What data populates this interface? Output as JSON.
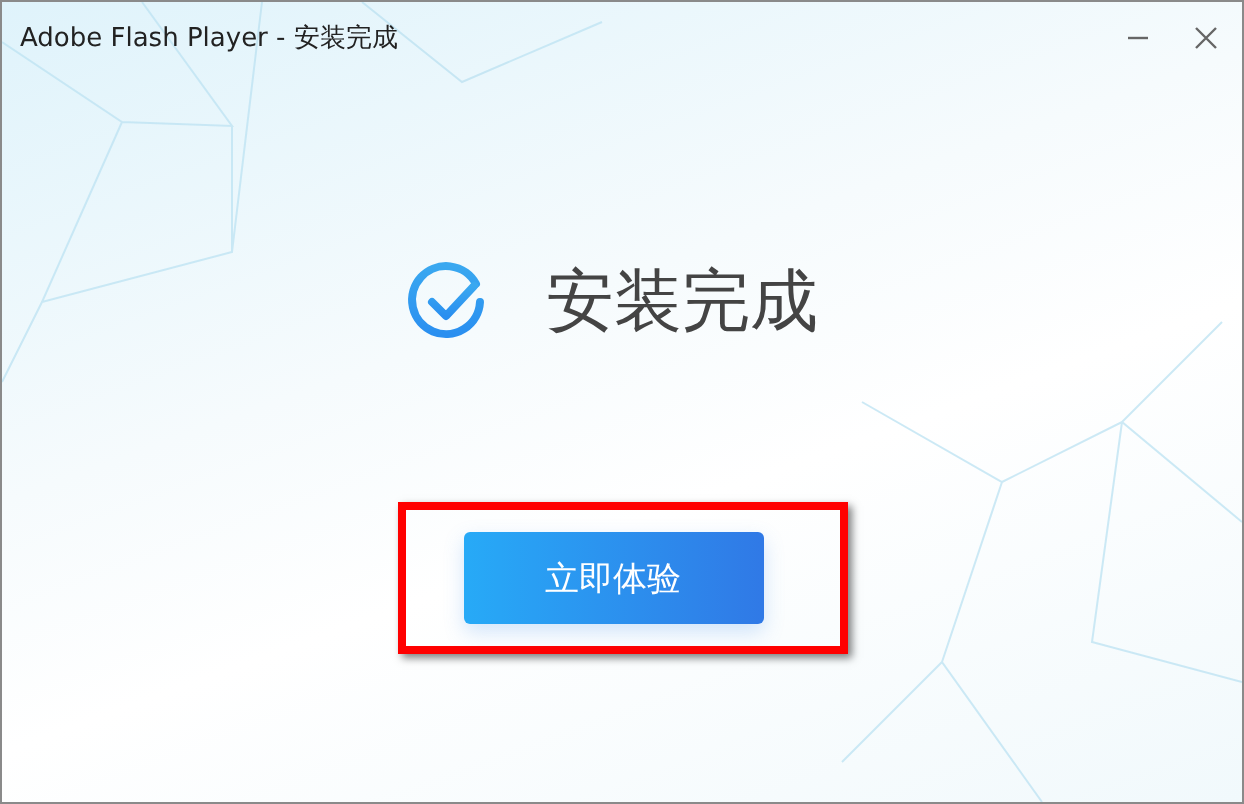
{
  "window": {
    "title": "Adobe Flash Player - 安装完成"
  },
  "status": {
    "kind": "success",
    "message": "安装完成"
  },
  "primary_button": {
    "label": "立即体验",
    "highlighted": true
  }
}
